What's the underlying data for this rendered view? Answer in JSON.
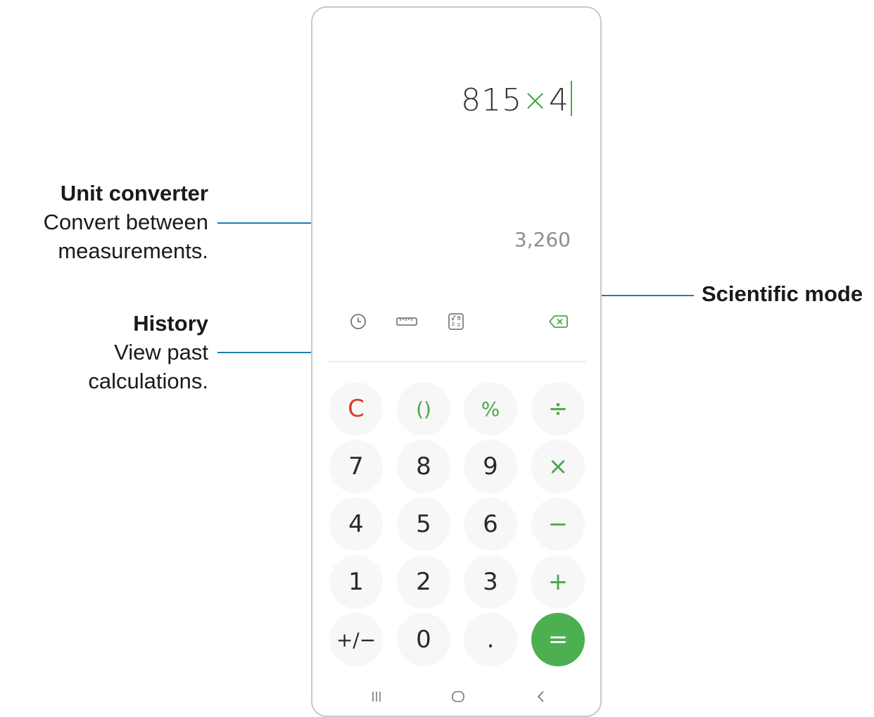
{
  "callouts": {
    "unit_converter": {
      "title": "Unit converter",
      "line1": "Convert between",
      "line2": "measurements."
    },
    "history": {
      "title": "History",
      "line1": "View past",
      "line2": "calculations."
    },
    "scientific": {
      "title": "Scientific mode"
    }
  },
  "display": {
    "expr_left": "815",
    "expr_op": "×",
    "expr_right": "4",
    "result": "3,260"
  },
  "toolbar": {
    "icons": [
      "history-icon",
      "ruler-icon",
      "scientific-icon",
      "backspace-icon"
    ]
  },
  "keypad": {
    "row1": [
      "C",
      "()",
      "%",
      "÷"
    ],
    "row2": [
      "7",
      "8",
      "9",
      "×"
    ],
    "row3": [
      "4",
      "5",
      "6",
      "−"
    ],
    "row4": [
      "1",
      "2",
      "3",
      "+"
    ],
    "row5": [
      "+/−",
      "0",
      ".",
      "="
    ]
  },
  "navbar": {
    "icons": [
      "recents-icon",
      "home-icon",
      "back-icon"
    ]
  },
  "colors": {
    "accent_green": "#4caf50",
    "clear_red": "#e0392e",
    "callout_line": "#1f7fb0"
  }
}
